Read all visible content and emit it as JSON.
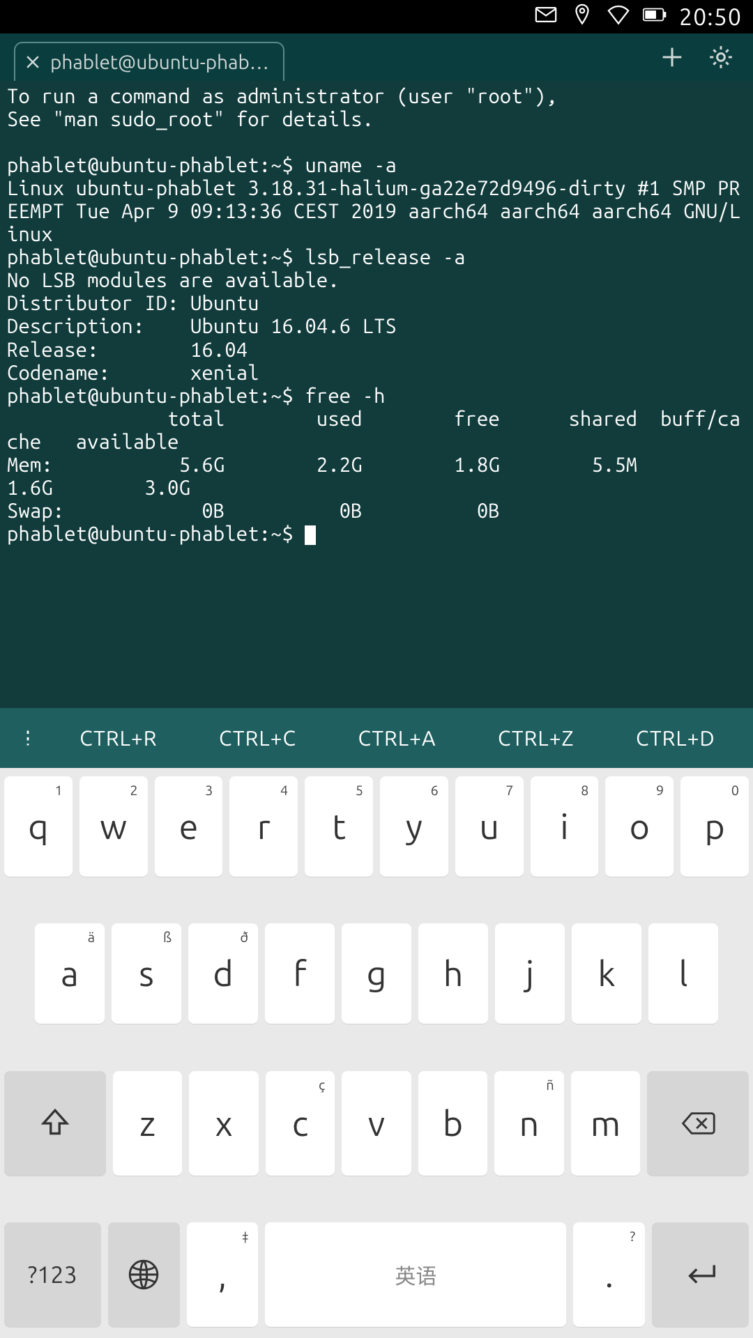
{
  "status": {
    "time": "20:50"
  },
  "tab": {
    "title": "phablet@ubuntu-phab…"
  },
  "terminal": {
    "lines": [
      "To run a command as administrator (user \"root\"),",
      "See \"man sudo_root\" for details.",
      "",
      "phablet@ubuntu-phablet:~$ uname -a",
      "Linux ubuntu-phablet 3.18.31-halium-ga22e72d9496-dirty #1 SMP PREEMPT Tue Apr 9 09:13:36 CEST 2019 aarch64 aarch64 aarch64 GNU/Linux",
      "phablet@ubuntu-phablet:~$ lsb_release -a",
      "No LSB modules are available.",
      "Distributor ID:\tUbuntu",
      "Description:\tUbuntu 16.04.6 LTS",
      "Release:\t16.04",
      "Codename:\txenial",
      "phablet@ubuntu-phablet:~$ free -h",
      "              total        used        free      shared  buff/cache   available",
      "Mem:           5.6G        2.2G        1.8G        5.5M        1.6G        3.0G",
      "Swap:            0B          0B          0B"
    ],
    "prompt": "phablet@ubuntu-phablet:~$ "
  },
  "shortcuts": [
    "CTRL+R",
    "CTRL+C",
    "CTRL+A",
    "CTRL+Z",
    "CTRL+D"
  ],
  "keyboard": {
    "row1": [
      {
        "m": "q",
        "s": "1"
      },
      {
        "m": "w",
        "s": "2"
      },
      {
        "m": "e",
        "s": "3"
      },
      {
        "m": "r",
        "s": "4"
      },
      {
        "m": "t",
        "s": "5"
      },
      {
        "m": "y",
        "s": "6"
      },
      {
        "m": "u",
        "s": "7"
      },
      {
        "m": "i",
        "s": "8"
      },
      {
        "m": "o",
        "s": "9"
      },
      {
        "m": "p",
        "s": "0"
      }
    ],
    "row2": [
      {
        "m": "a",
        "s": "ä"
      },
      {
        "m": "s",
        "s": "ß"
      },
      {
        "m": "d",
        "s": "ð"
      },
      {
        "m": "f",
        "s": ""
      },
      {
        "m": "g",
        "s": ""
      },
      {
        "m": "h",
        "s": ""
      },
      {
        "m": "j",
        "s": ""
      },
      {
        "m": "k",
        "s": ""
      },
      {
        "m": "l",
        "s": ""
      }
    ],
    "row3": [
      {
        "m": "z",
        "s": ""
      },
      {
        "m": "x",
        "s": ""
      },
      {
        "m": "c",
        "s": "ç"
      },
      {
        "m": "v",
        "s": ""
      },
      {
        "m": "b",
        "s": ""
      },
      {
        "m": "n",
        "s": "ñ"
      },
      {
        "m": "m",
        "s": ""
      }
    ],
    "row4": {
      "sym": "?123",
      "comma": ",",
      "comma_s": "‡",
      "space": "英语",
      "period": ".",
      "period_s": "?"
    }
  }
}
